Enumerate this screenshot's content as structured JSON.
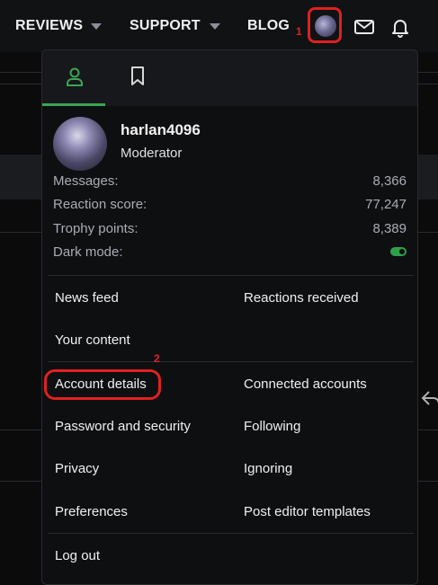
{
  "nav": {
    "reviews": "REVIEWS",
    "support": "SUPPORT",
    "blog": "BLOG"
  },
  "annotations": {
    "one": "1",
    "two": "2"
  },
  "icons": {
    "mail": "envelope-icon",
    "bell": "bell-icon",
    "profile_tab": "person-icon",
    "bookmarks_tab": "bookmark-icon"
  },
  "user": {
    "name": "harlan4096",
    "role": "Moderator"
  },
  "stats": [
    {
      "label": "Messages:",
      "value": "8,366"
    },
    {
      "label": "Reaction score:",
      "value": "77,247"
    },
    {
      "label": "Trophy points:",
      "value": "8,389"
    },
    {
      "label": "Dark mode:",
      "value": ""
    }
  ],
  "dark_mode_on": true,
  "menu": {
    "news_feed": "News feed",
    "reactions_received": "Reactions received",
    "your_content": "Your content",
    "account_details": "Account details",
    "connected_accounts": "Connected accounts",
    "password_security": "Password and security",
    "following": "Following",
    "privacy": "Privacy",
    "ignoring": "Ignoring",
    "preferences": "Preferences",
    "post_editor_templates": "Post editor templates",
    "log_out": "Log out"
  },
  "colors": {
    "accent_green": "#3aa655",
    "highlight_red": "#e02020"
  }
}
